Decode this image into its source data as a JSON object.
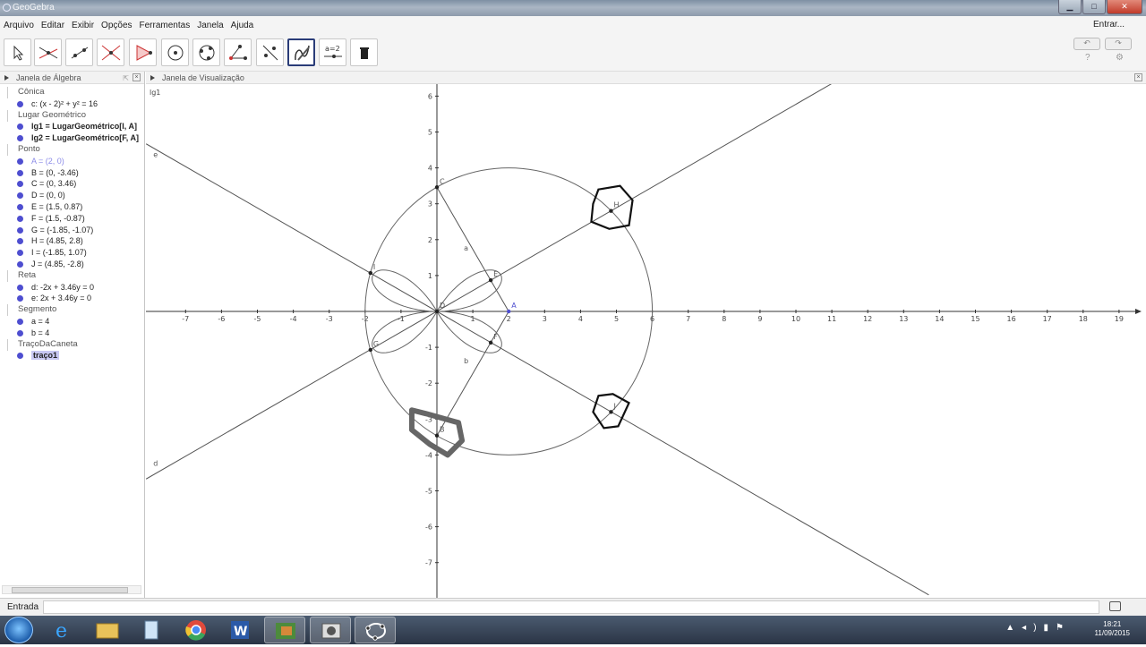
{
  "window": {
    "title": "GeoGebra",
    "min": "▁",
    "max": "□",
    "close": "✕"
  },
  "menu": {
    "items": [
      "Arquivo",
      "Editar",
      "Exibir",
      "Opções",
      "Ferramentas",
      "Janela",
      "Ajuda"
    ],
    "login": "Entrar..."
  },
  "toolbar": {
    "tools": [
      "move-tool",
      "point-tool",
      "line-tool",
      "perpendicular-line-tool",
      "polygon-tool",
      "circle-tool",
      "conic-tool",
      "angle-tool",
      "reflect-tool",
      "pen-tool",
      "slider-tool",
      "delete-tool"
    ],
    "selected_index": 9,
    "slider_label": "a=2",
    "undo": "↶",
    "redo": "↷",
    "help": "?",
    "settings": "⚙"
  },
  "algebra": {
    "title": "Janela de Álgebra",
    "groups": [
      {
        "name": "Cônica",
        "items": [
          {
            "text": "c: (x - 2)² + y² = 16",
            "style": "normal"
          }
        ]
      },
      {
        "name": "Lugar Geométrico",
        "items": [
          {
            "text": "lg1 = LugarGeométrico[I, A]",
            "style": "bold"
          },
          {
            "text": "lg2 = LugarGeométrico[F, A]",
            "style": "bold"
          }
        ]
      },
      {
        "name": "Ponto",
        "items": [
          {
            "text": "A = (2, 0)",
            "style": "light"
          },
          {
            "text": "B = (0, -3.46)",
            "style": "normal"
          },
          {
            "text": "C = (0, 3.46)",
            "style": "normal"
          },
          {
            "text": "D = (0, 0)",
            "style": "normal"
          },
          {
            "text": "E = (1.5, 0.87)",
            "style": "normal"
          },
          {
            "text": "F = (1.5, -0.87)",
            "style": "normal"
          },
          {
            "text": "G = (-1.85, -1.07)",
            "style": "normal"
          },
          {
            "text": "H = (4.85, 2.8)",
            "style": "normal"
          },
          {
            "text": "I = (-1.85, 1.07)",
            "style": "normal"
          },
          {
            "text": "J = (4.85, -2.8)",
            "style": "normal"
          }
        ]
      },
      {
        "name": "Reta",
        "items": [
          {
            "text": "d: -2x + 3.46y = 0",
            "style": "normal"
          },
          {
            "text": "e: 2x + 3.46y = 0",
            "style": "normal"
          }
        ]
      },
      {
        "name": "Segmento",
        "items": [
          {
            "text": "a = 4",
            "style": "normal"
          },
          {
            "text": "b = 4",
            "style": "normal"
          }
        ]
      },
      {
        "name": "TraçoDaCaneta",
        "items": [
          {
            "text": "traço1",
            "style": "selected"
          }
        ]
      }
    ]
  },
  "graphics": {
    "title": "Janela de Visualização",
    "corner_label": "lg1",
    "x_ticks": [
      "-7",
      "-6",
      "-5",
      "-4",
      "-3",
      "-2",
      "-1",
      "1",
      "2",
      "3",
      "4",
      "5",
      "6",
      "7",
      "8",
      "9",
      "10",
      "11",
      "12",
      "13",
      "14",
      "15",
      "16",
      "17",
      "18",
      "19"
    ],
    "y_ticks": [
      "6",
      "5",
      "4",
      "3",
      "2",
      "1",
      "-1",
      "-2",
      "-3",
      "-4",
      "-5",
      "-6",
      "-7"
    ],
    "circle": {
      "center": [
        2,
        0
      ],
      "radius": 4
    },
    "points": [
      {
        "name": "A",
        "x": 2,
        "y": 0
      },
      {
        "name": "B",
        "x": 0,
        "y": -3.46
      },
      {
        "name": "C",
        "x": 0,
        "y": 3.46
      },
      {
        "name": "D",
        "x": 0,
        "y": 0
      },
      {
        "name": "E",
        "x": 1.5,
        "y": 0.87
      },
      {
        "name": "F",
        "x": 1.5,
        "y": -0.87
      },
      {
        "name": "G",
        "x": -1.85,
        "y": -1.07
      },
      {
        "name": "H",
        "x": 4.85,
        "y": 2.8
      },
      {
        "name": "I",
        "x": -1.85,
        "y": 1.07
      },
      {
        "name": "J",
        "x": 4.85,
        "y": -2.8
      }
    ],
    "segment_labels": [
      {
        "name": "a",
        "x": 0.75,
        "y": 1.7
      },
      {
        "name": "b",
        "x": 0.75,
        "y": -1.45
      }
    ],
    "line_labels": [
      {
        "name": "e",
        "x": -7.9,
        "y": 4.3
      },
      {
        "name": "d",
        "x": -7.9,
        "y": -4.3
      }
    ]
  },
  "input": {
    "label": "Entrada"
  },
  "taskbar": {
    "time": "18:21",
    "date": "11/09/2015"
  }
}
